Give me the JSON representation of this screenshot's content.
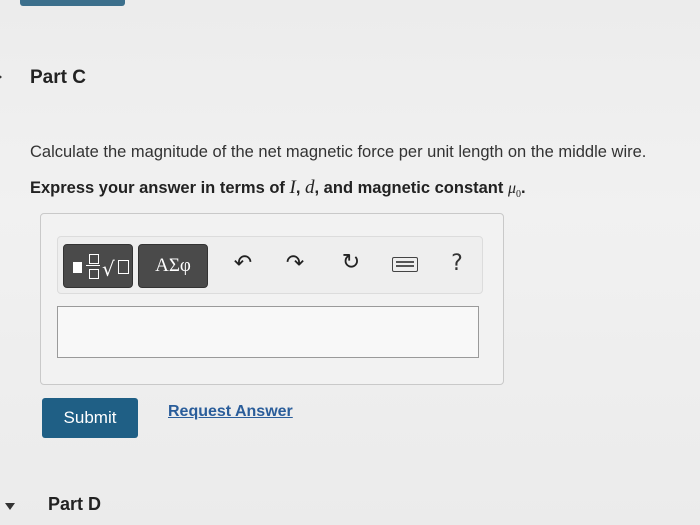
{
  "part_c": {
    "title": "Part C",
    "question": "Calculate the magnitude of the net magnetic force per unit length on the middle wire.",
    "instruction": {
      "prefix": "Express your answer in terms of ",
      "var1": "I",
      "sep1": ", ",
      "var2": "d",
      "sep2": ", and magnetic constant ",
      "mu": "μ",
      "mu_sub": "0",
      "suffix": "."
    }
  },
  "toolbar": {
    "symbols_label": "ΑΣφ",
    "undo_icon": "↶",
    "redo_icon": "↷",
    "reset_icon": "↻",
    "help_label": "?"
  },
  "actions": {
    "submit_label": "Submit",
    "request_label": "Request Answer"
  },
  "part_d": {
    "title": "Part D"
  }
}
